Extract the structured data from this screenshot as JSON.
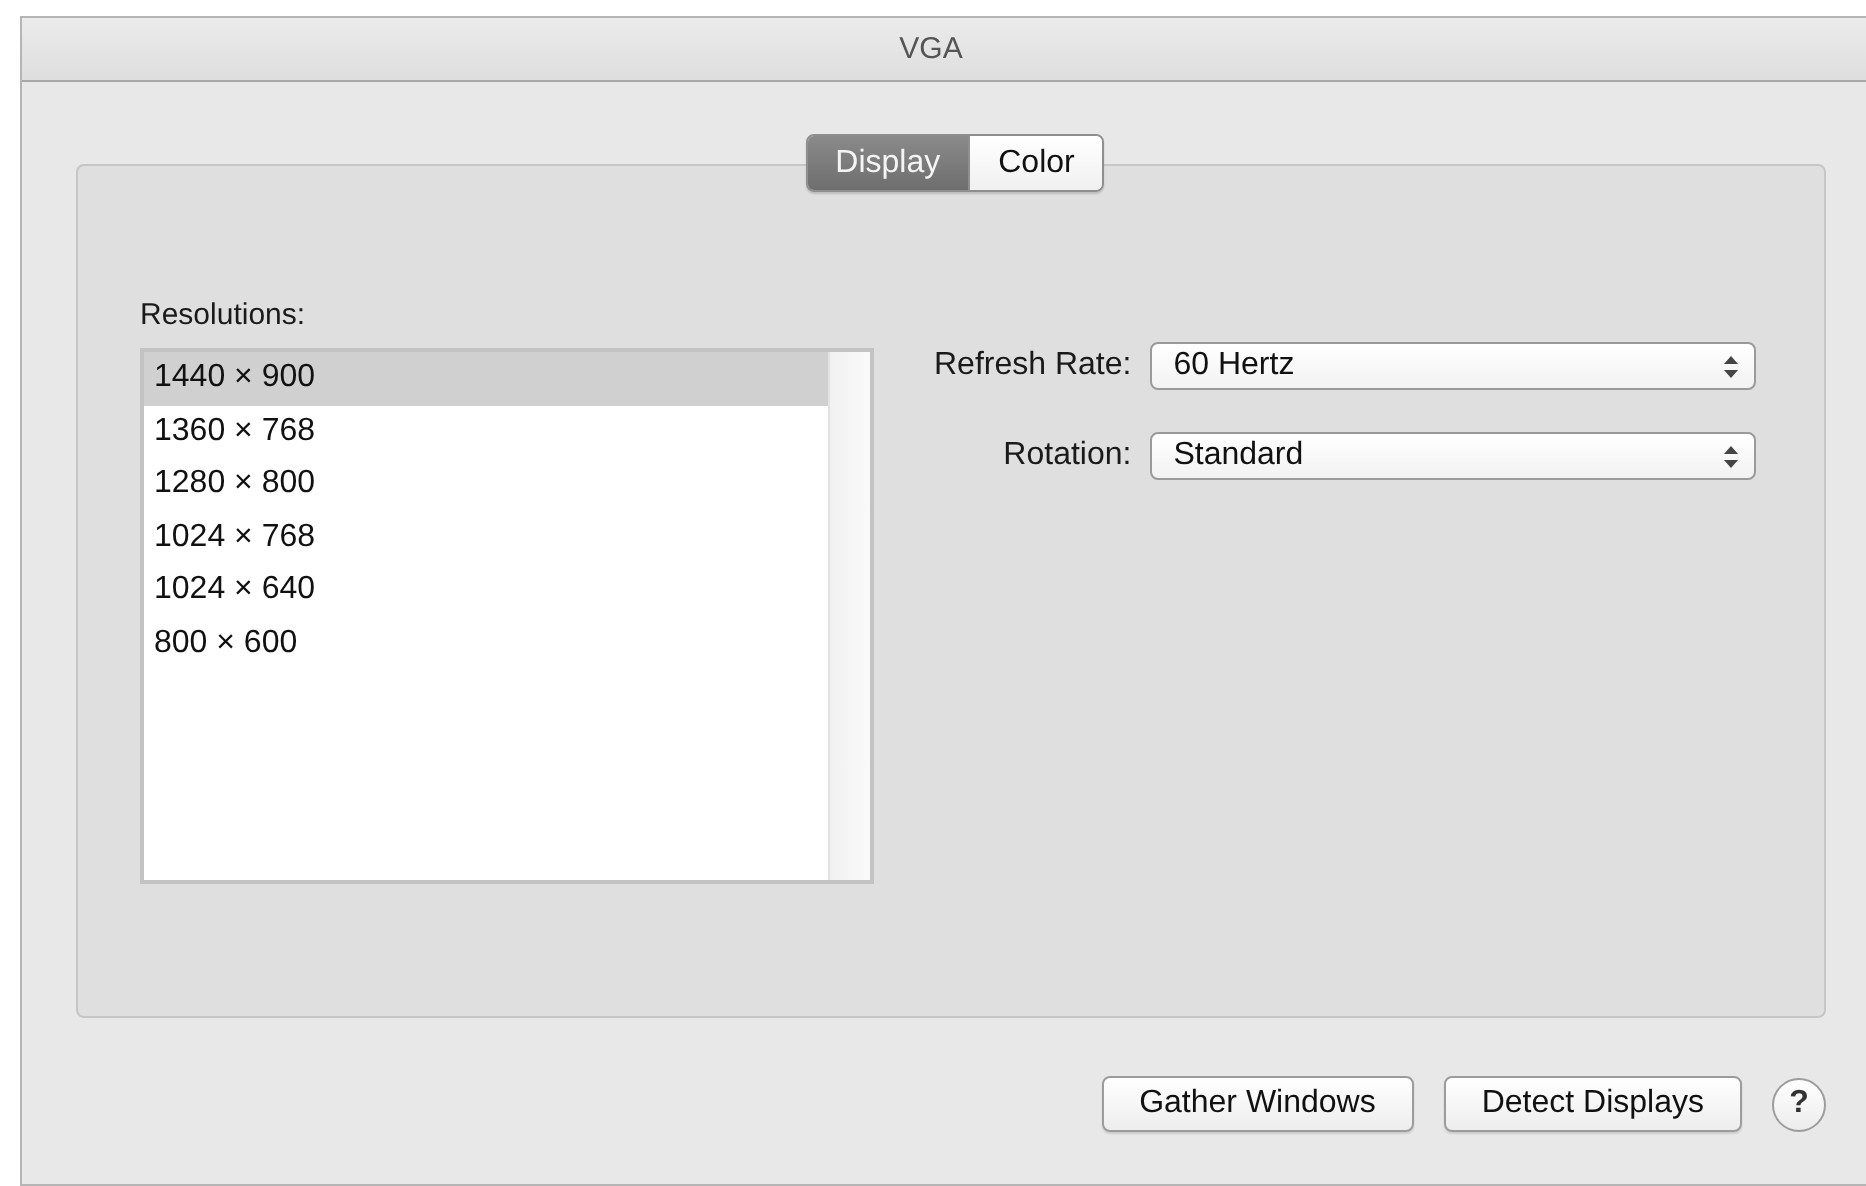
{
  "window": {
    "title": "VGA"
  },
  "tabs": [
    {
      "label": "Display",
      "selected": true
    },
    {
      "label": "Color",
      "selected": false
    }
  ],
  "resolutions": {
    "label": "Resolutions:",
    "items": [
      {
        "label": "1440 × 900",
        "selected": true
      },
      {
        "label": "1360 × 768",
        "selected": false
      },
      {
        "label": "1280 × 800",
        "selected": false
      },
      {
        "label": "1024 × 768",
        "selected": false
      },
      {
        "label": "1024 × 640",
        "selected": false
      },
      {
        "label": "800 × 600",
        "selected": false
      }
    ]
  },
  "settings": [
    {
      "label": "Refresh Rate:",
      "value": "60 Hertz"
    },
    {
      "label": "Rotation:",
      "value": "Standard"
    }
  ],
  "buttons": [
    "Gather Windows",
    "Detect Displays"
  ],
  "help": "?"
}
